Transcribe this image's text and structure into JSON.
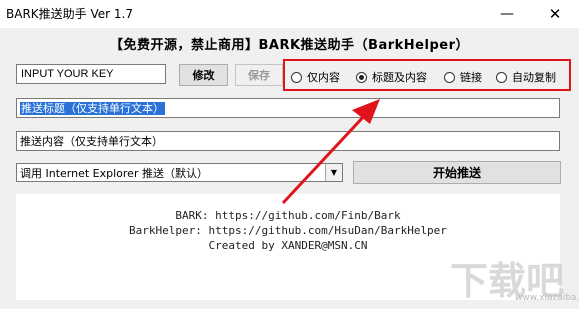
{
  "window": {
    "title": "BARK推送助手 Ver 1.7",
    "minimize": "—",
    "close": "✕"
  },
  "header": "【免费开源，禁止商用】BARK推送助手（BarkHelper）",
  "key": {
    "value": "INPUT YOUR KEY"
  },
  "buttons": {
    "modify": "修改",
    "save": "保存",
    "send": "开始推送"
  },
  "radio_options": [
    {
      "label": "仅内容",
      "selected": false
    },
    {
      "label": "标题及内容",
      "selected": true
    },
    {
      "label": "链接",
      "selected": false
    },
    {
      "label": "自动复制",
      "selected": false
    }
  ],
  "title_field": "推送标题（仅支持单行文本）",
  "content_field": "推送内容（仅支持单行文本）",
  "browser_select": "调用 Internet Explorer 推送（默认）",
  "info": {
    "line1": "BARK: https://github.com/Finb/Bark",
    "line2": "BarkHelper: https://github.com/HsuDan/BarkHelper",
    "line3": "Created by XANDER@MSN.CN"
  },
  "watermark": {
    "main": "下载吧",
    "sub": "www.xiazaiba.com"
  },
  "colors": {
    "highlight": "#e0141b",
    "selection": "#2a72d8"
  }
}
